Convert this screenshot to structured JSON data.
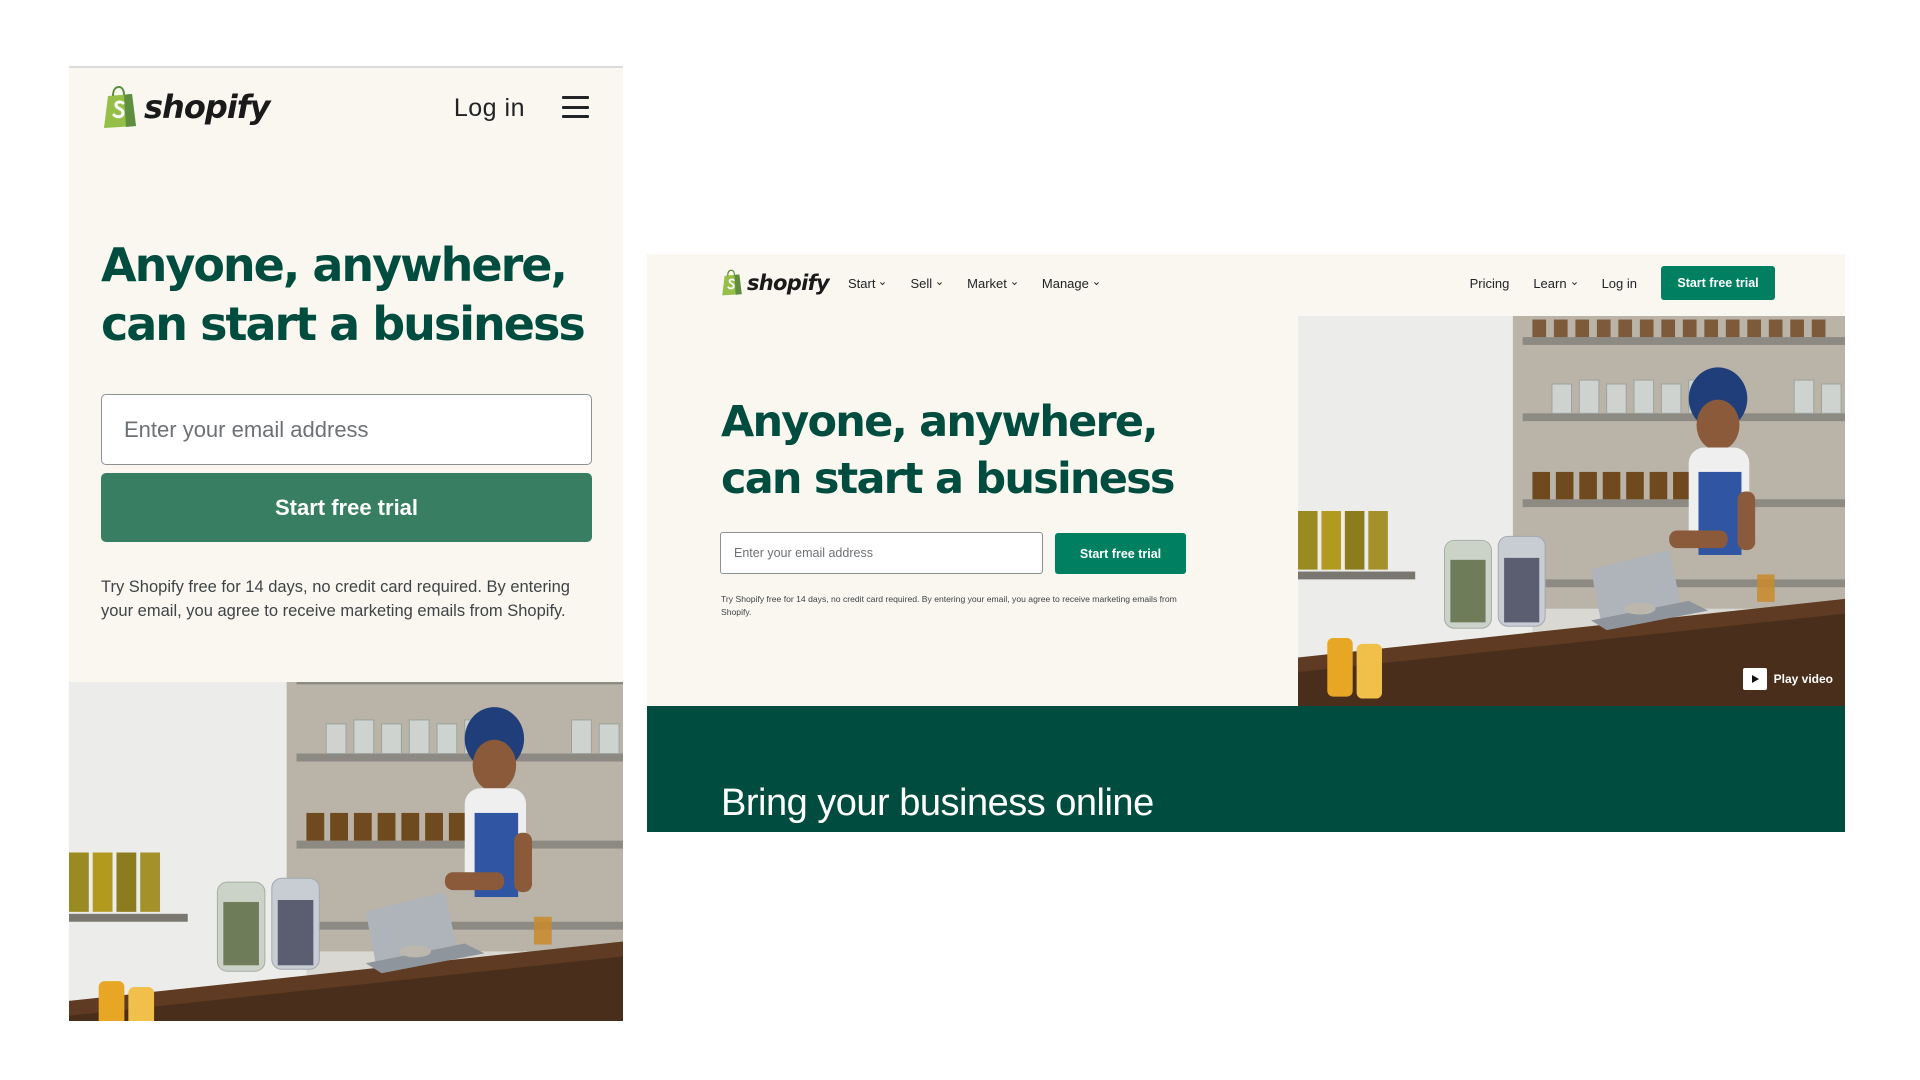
{
  "mobile": {
    "logo_text": "shopify",
    "login_label": "Log in",
    "menu_icon": "hamburger-menu-icon",
    "headline_line1": "Anyone, anywhere,",
    "headline_line2": "can start a business",
    "email_placeholder": "Enter your email address",
    "cta_label": "Start free trial",
    "note": "Try Shopify free for 14 days, no credit card required. By entering your email, you agree to receive marketing emails from Shopify."
  },
  "desktop": {
    "logo_text": "shopify",
    "nav": [
      {
        "label": "Start"
      },
      {
        "label": "Sell"
      },
      {
        "label": "Market"
      },
      {
        "label": "Manage"
      }
    ],
    "right_nav": {
      "pricing": "Pricing",
      "learn": "Learn",
      "login": "Log in",
      "cta": "Start free trial"
    },
    "headline_line1": "Anyone, anywhere,",
    "headline_line2": "can start a business",
    "email_placeholder": "Enter your email address",
    "cta_label": "Start free trial",
    "note": "Try Shopify free for 14 days, no credit card required. By entering your email, you agree to receive marketing emails from Shopify.",
    "play_label": "Play video",
    "band_title": "Bring your business online"
  },
  "colors": {
    "brand_dark_green": "#004c3f",
    "brand_green": "#008060",
    "mobile_button_green": "#377e62",
    "cream_background": "#f9f7ef",
    "logo_bag_green": "#95bf47"
  }
}
